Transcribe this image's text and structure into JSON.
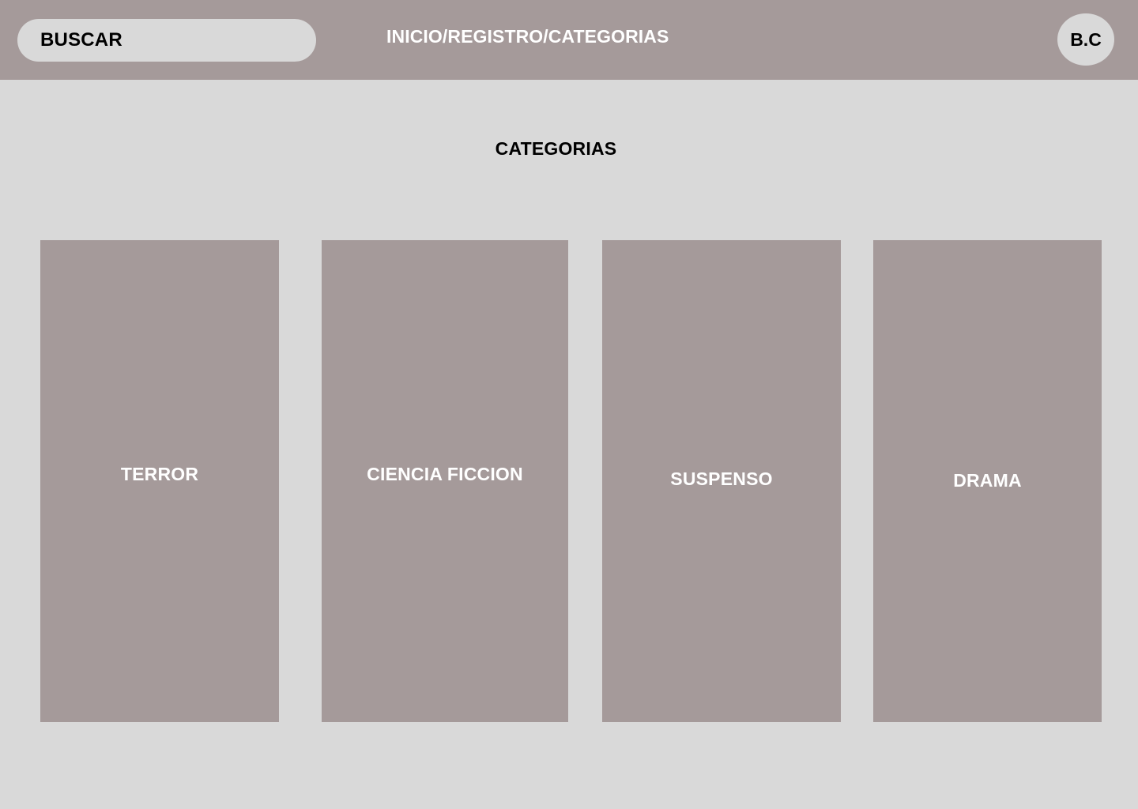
{
  "header": {
    "search_label": "BUSCAR",
    "nav_text": "INICIO/REGISTRO/CATEGORIAS",
    "avatar_initials": "B.C"
  },
  "main": {
    "title": "CATEGORIAS",
    "categories": [
      {
        "label": "TERROR"
      },
      {
        "label": "CIENCIA FICCION"
      },
      {
        "label": "SUSPENSO"
      },
      {
        "label": "DRAMA"
      }
    ]
  },
  "colors": {
    "header_background": "#a59a9a",
    "page_background": "#d9d9d9",
    "card_background": "#a59a9a",
    "primary_text": "#000000",
    "inverse_text": "#ffffff"
  }
}
